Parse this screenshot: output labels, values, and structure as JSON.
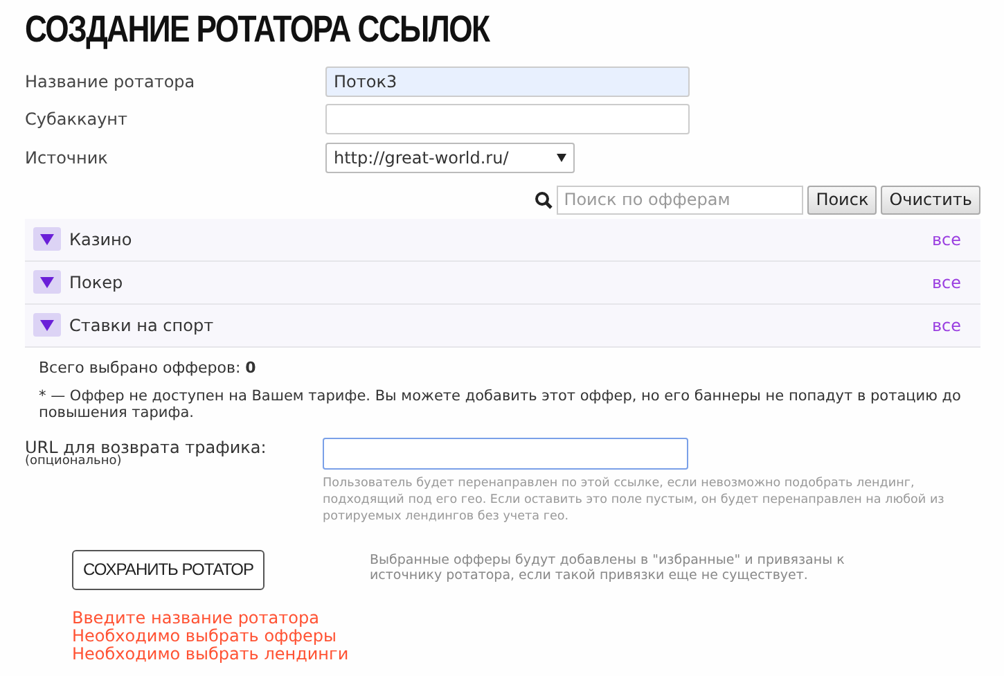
{
  "title": "СОЗДАНИЕ РОТАТОРА ССЫЛОК",
  "fields": [
    {
      "kind": "text",
      "label": "Название ротатора",
      "value": "Поток3",
      "autofilled": true
    },
    {
      "kind": "text",
      "label": "Субаккаунт",
      "autofilled": false
    },
    {
      "kind": "select",
      "label": "Источник",
      "value": "http://great-world.ru/"
    }
  ],
  "search": {
    "placeholder": "Поиск по офферам",
    "buttons": [
      "Поиск",
      "Очистить"
    ]
  },
  "categories": [
    {
      "name": "Казино",
      "link": "все"
    },
    {
      "name": "Покер",
      "link": "все"
    },
    {
      "name": "Ставки на спорт",
      "link": "все"
    }
  ],
  "total": {
    "label": "Всего выбрано офферов:",
    "value": "0"
  },
  "note": "* — Оффер не доступен на Вашем тарифе. Вы можете добавить этот оффер, но его баннеры не попадут в ротацию до повышения тарифа.",
  "return_url": {
    "label": "URL для возврата трафика:",
    "sublabel": "(опционально)",
    "help": "Пользователь будет перенаправлен по этой ссылке, если невозможно подобрать лендинг, подходящий под его гео. Если оставить это поле пустым, он будет перенаправлен на любой из ротируемых лендингов без учета гео."
  },
  "save_button": "СОХРАНИТЬ РОТАТОР",
  "save_note": "Выбранные офферы будут добавлены в \"избранные\" и привязаны к источнику ротатора, если такой привязки еще не существует.",
  "errors": [
    "Введите название ротатора",
    "Необходимо выбрать офферы",
    "Необходимо выбрать лендинги"
  ]
}
